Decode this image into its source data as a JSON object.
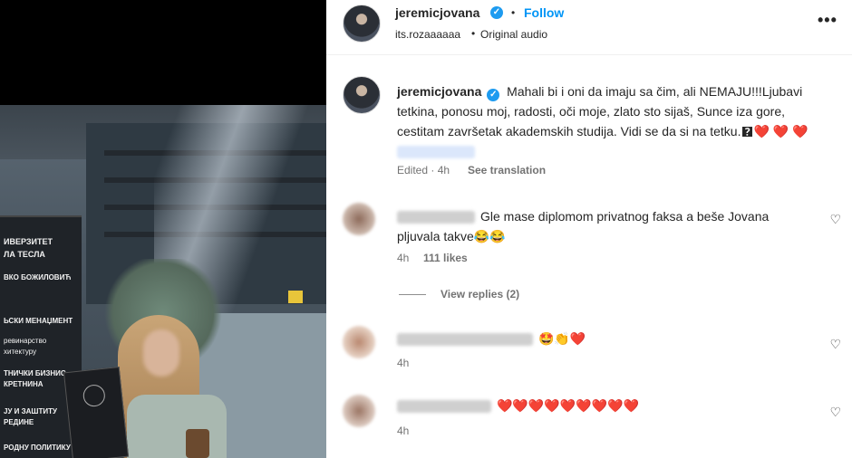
{
  "post": {
    "author": "jeremicjovana",
    "follow_label": "Follow",
    "separator": "•",
    "audio_user": "its.rozaaaaaa",
    "audio_label": "Original audio",
    "more_label": "•••"
  },
  "caption": {
    "author": "jeremicjovana",
    "text": "Mahali bi i oni da imaju sa čim, ali NEMAJU!!!Ljubavi tetkina, ponosu moj, radosti, oči moje, zlato sto sijaš, Sunce iza gore, cestitam završetak akademskih studija. Vidi se da si na tetku.",
    "emoji_box": "🯄",
    "hearts": "❤️ ❤️ ❤️",
    "edited": "Edited · 4h",
    "see_translation": "See translation"
  },
  "comments": [
    {
      "text": "Gle mase diplomom privatnog faksa a beše Jovana pljuvala takve😂😂",
      "time": "4h",
      "likes": "111 likes",
      "view_replies": "View replies (2)"
    },
    {
      "text": "🤩👏❤️",
      "time": "4h"
    },
    {
      "text": "❤️❤️❤️❤️❤️❤️❤️❤️❤️",
      "time": "4h"
    }
  ],
  "icons": {
    "like": "♡",
    "verified": "✓"
  },
  "sign_lines": [
    "ИВЕРЗИТЕТ",
    "ЛА ТЕСЛА",
    "ВКО БОЖИЛОВИЋ",
    "ЬСКИ МЕНАЏМЕНТ",
    "ревинарство",
    "хитектуру",
    "ТНИЧКИ БИЗНИС",
    "КРЕТНИНА",
    "ЈУ И ЗАШТИТУ",
    "РЕДИНЕ",
    "РОДНУ ПОЛИТИКУ"
  ]
}
